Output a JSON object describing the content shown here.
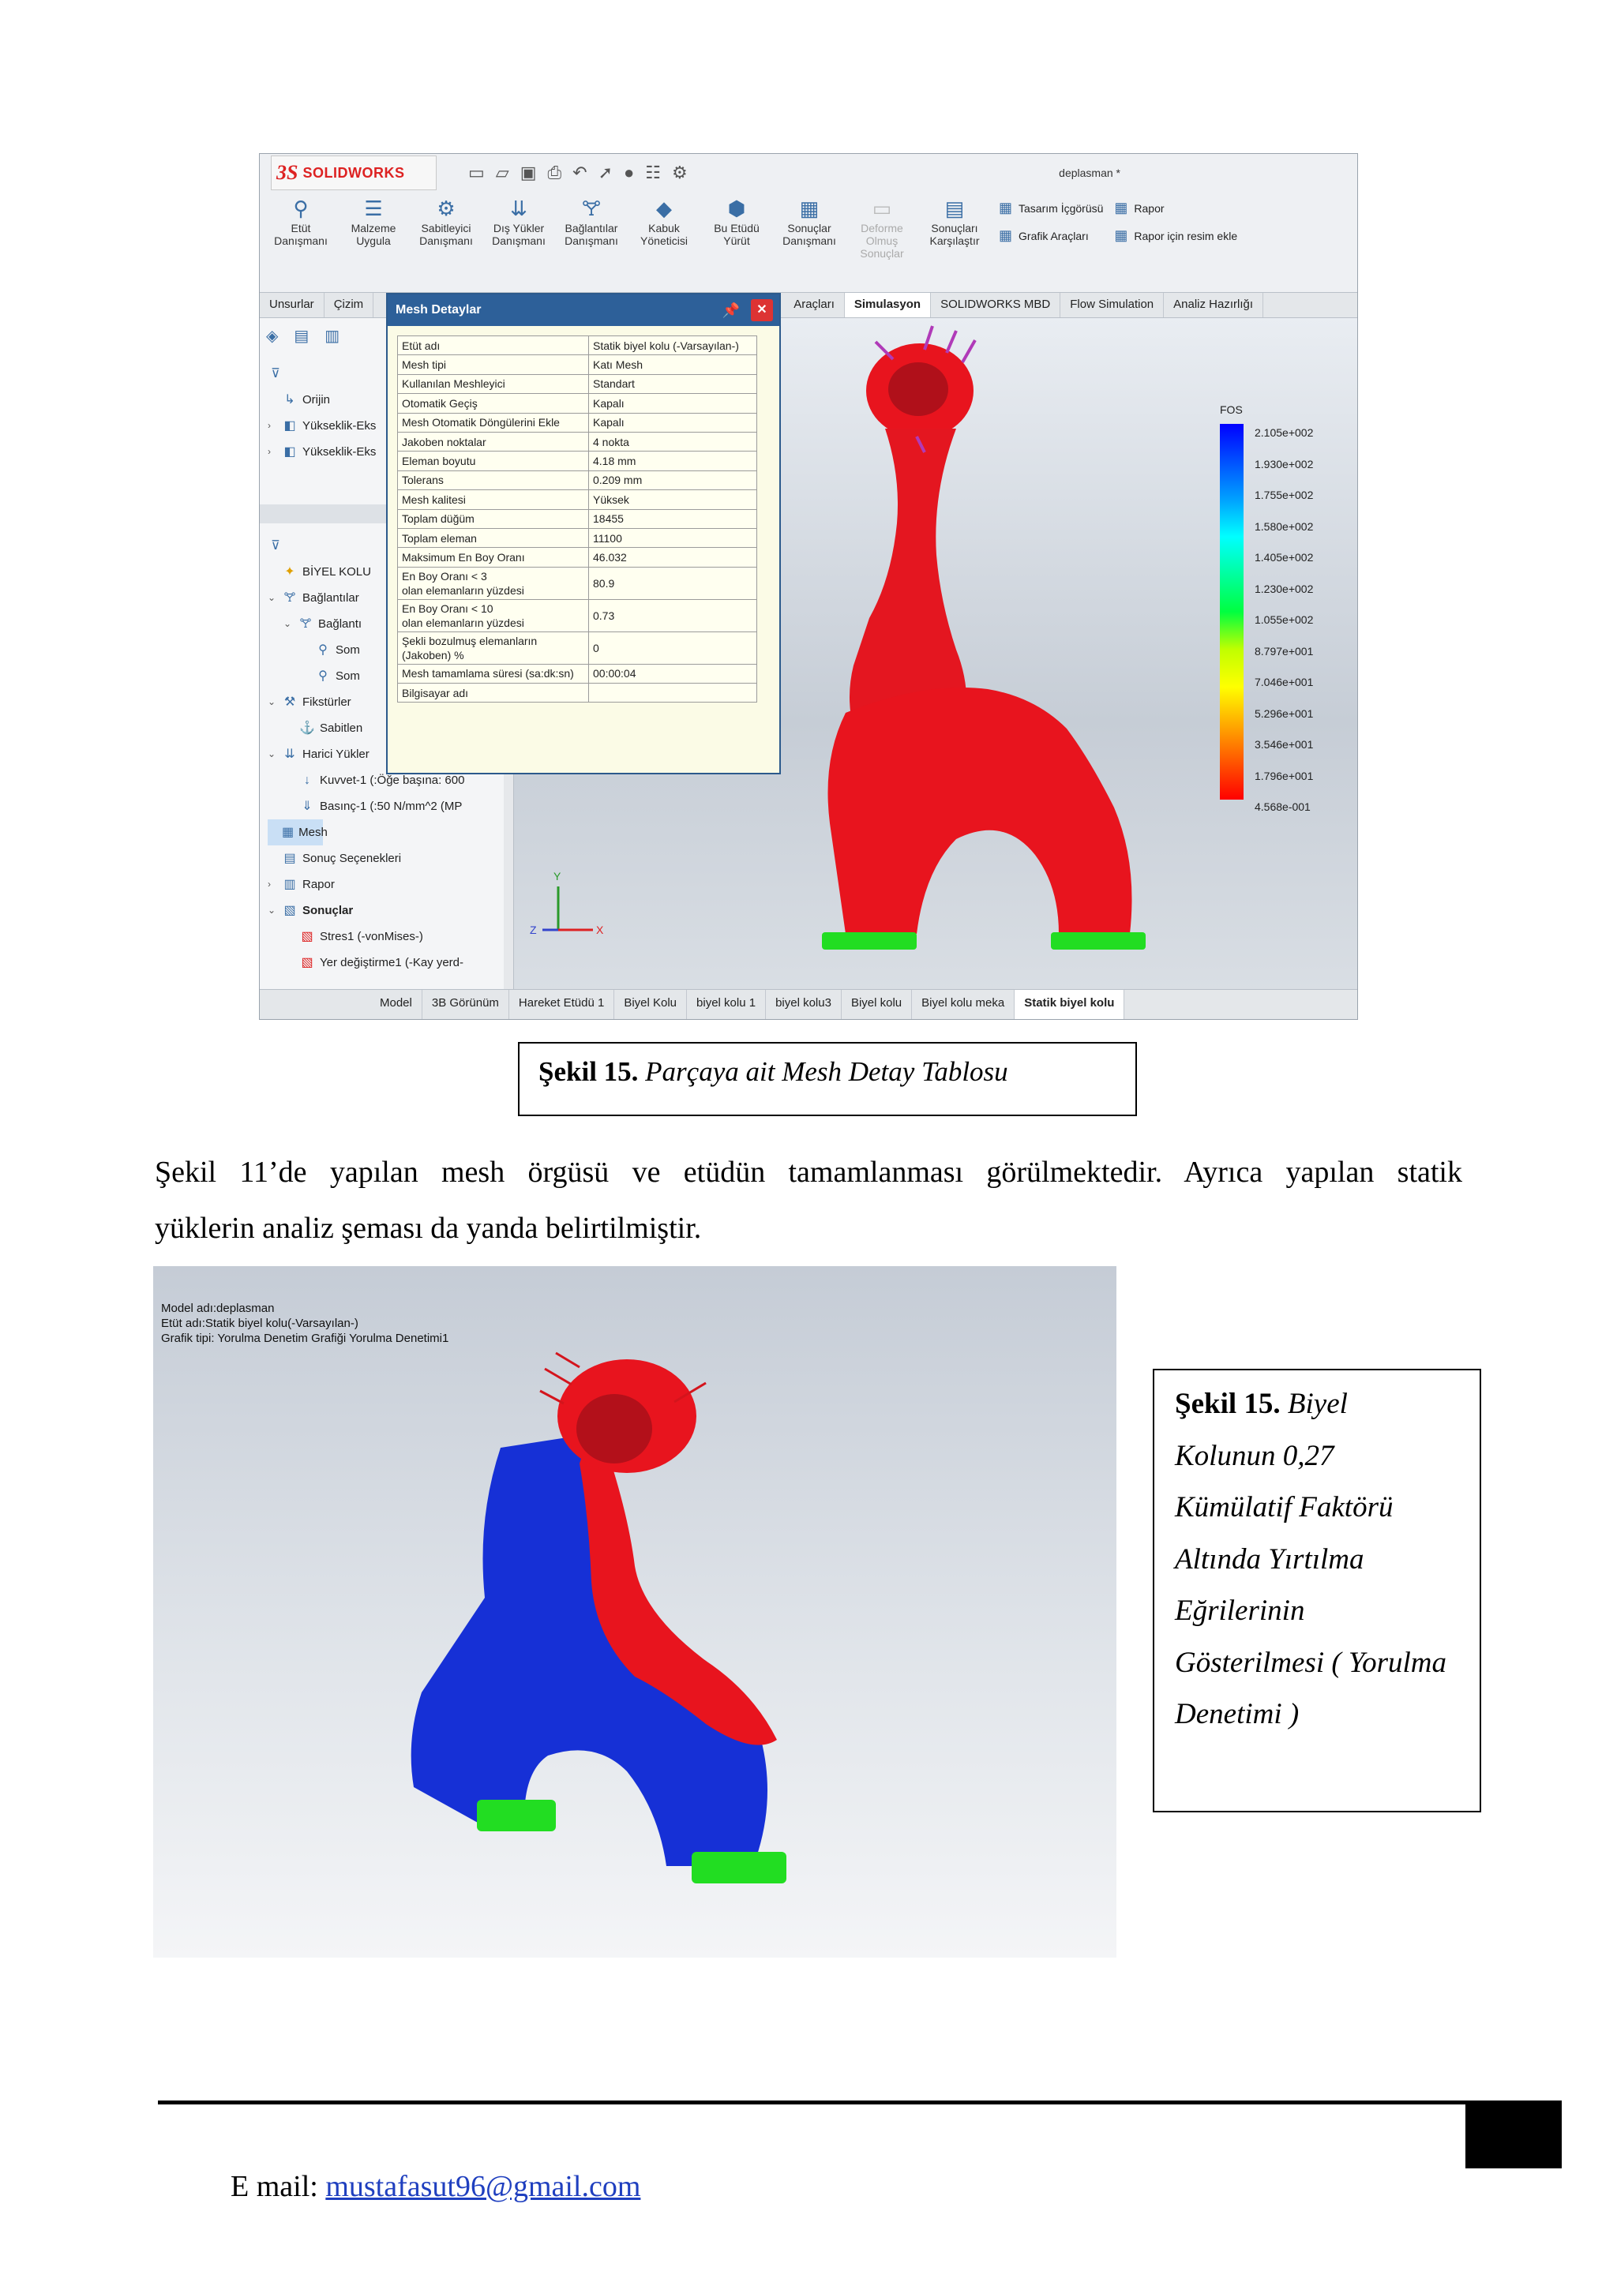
{
  "figure1": {
    "logo": "SOLIDWORKS",
    "document_name": "deplasman *",
    "ribbon": [
      {
        "label": "Etüt\nDanışmanı",
        "icon": "study-advisor-icon"
      },
      {
        "label": "Malzeme\nUygula",
        "icon": "apply-material-icon"
      },
      {
        "label": "Sabitleyici\nDanışmanı",
        "icon": "fixtures-advisor-icon"
      },
      {
        "label": "Dış Yükler\nDanışmanı",
        "icon": "external-loads-icon"
      },
      {
        "label": "Bağlantılar\nDanışmanı",
        "icon": "connections-advisor-icon"
      },
      {
        "label": "Kabuk\nYöneticisi",
        "icon": "shell-manager-icon"
      },
      {
        "label": "Bu Etüdü\nYürüt",
        "icon": "run-study-icon"
      },
      {
        "label": "Sonuçlar\nDanışmanı",
        "icon": "results-advisor-icon"
      },
      {
        "label": "Deforme\nOlmuş\nSonuçlar",
        "icon": "deformed-results-icon"
      },
      {
        "label": "Sonuçları\nKarşılaştır",
        "icon": "compare-results-icon"
      }
    ],
    "ribbon_stack1": [
      "Tasarım İçgörüsü",
      "Grafik Araçları"
    ],
    "ribbon_stack2": [
      "Rapor",
      "Rapor için resim ekle"
    ],
    "tabs": [
      "Unsurlar",
      "Çizim",
      "Araçları",
      "Simulasyon",
      "SOLIDWORKS MBD",
      "Flow Simulation",
      "Analiz Hazırlığı"
    ],
    "tree": {
      "origin": "Orijin",
      "plane1": "Yükseklik-Eks",
      "plane2": "Yükseklik-Eks",
      "part": "BİYEL KOLU",
      "connections": "Bağlantılar",
      "connection": "Bağlantı",
      "som1": "Som",
      "som2": "Som",
      "fixtures": "Fikstürler",
      "fixed": "Sabitlen",
      "external_loads": "Harici Yükler",
      "force": "Kuvvet-1 (:Öğe başına: 600",
      "pressure": "Basınç-1 (:50 N/mm^2 (MP",
      "mesh": "Mesh",
      "result_options": "Sonuç Seçenekleri",
      "report": "Rapor",
      "results": "Sonuçlar",
      "stress": "Stres1 (-vonMises-)",
      "displacement": "Yer değiştirme1 (-Kay yerd-"
    },
    "bottom_tabs": [
      "Model",
      "3B Görünüm",
      "Hareket Etüdü 1",
      "Biyel Kolu",
      "biyel kolu 1",
      "biyel kolu3",
      "Biyel kolu",
      "Biyel kolu meka",
      "Statik biyel kolu"
    ],
    "legend": {
      "title": "FOS",
      "labels": [
        "2.105e+002",
        "1.930e+002",
        "1.755e+002",
        "1.580e+002",
        "1.405e+002",
        "1.230e+002",
        "1.055e+002",
        "8.797e+001",
        "7.046e+001",
        "5.296e+001",
        "3.546e+001",
        "1.796e+001",
        "4.568e-001"
      ]
    },
    "dialog": {
      "title": "Mesh Detaylar",
      "rows": [
        [
          "Etüt adı",
          "Statik biyel kolu (-Varsayılan-)"
        ],
        [
          "Mesh tipi",
          "Katı Mesh"
        ],
        [
          "Kullanılan Meshleyici",
          "Standart"
        ],
        [
          "Otomatik Geçiş",
          "Kapalı"
        ],
        [
          "Mesh Otomatik Döngülerini Ekle",
          "Kapalı"
        ],
        [
          "Jakoben noktalar",
          "4 nokta"
        ],
        [
          "Eleman boyutu",
          "4.18 mm"
        ],
        [
          "Tolerans",
          "0.209 mm"
        ],
        [
          "Mesh kalitesi",
          "Yüksek"
        ],
        [
          "Toplam düğüm",
          "18455"
        ],
        [
          "Toplam eleman",
          "11100"
        ],
        [
          "Maksimum En Boy Oranı",
          "46.032"
        ],
        [
          "En Boy Oranı < 3\nolan elemanların yüzdesi",
          "80.9"
        ],
        [
          "En Boy Oranı < 10\nolan elemanların yüzdesi",
          "0.73"
        ],
        [
          "Şekli bozulmuş elemanların\n(Jakoben) %",
          "0"
        ],
        [
          "Mesh tamamlama süresi (sa:dk:sn)",
          "00:00:04"
        ],
        [
          "Bilgisayar adı",
          ""
        ]
      ]
    },
    "colors": {
      "accent_red": "#e8141e",
      "mesh_green": "#22dd22",
      "dialog_header": "#2d6099"
    }
  },
  "caption1": {
    "bold": "Şekil 15.",
    "italic": "Parçaya ait Mesh Detay Tablosu"
  },
  "paragraph": {
    "line1": "Şekil 11’de yapılan mesh örgüsü ve etüdün tamamlanması görülmektedir. Ayrıca yapılan statik",
    "line2": "yüklerin analiz şeması da yanda belirtilmiştir."
  },
  "figure2": {
    "info_line1": "Model adı:deplasman",
    "info_line2": "Etüt adı:Statik biyel kolu(-Varsayılan-)",
    "info_line3": "Grafik tipi: Yorulma Denetim Grafiği Yorulma Denetimi1"
  },
  "caption2": {
    "bold": "Şekil 15.",
    "lines": [
      "Biyel",
      "Kolunun 0,27",
      "Kümülatif Faktörü",
      "Altında Yırtılma",
      "Eğrilerinin",
      "Gösterilmesi ( Yorulma",
      "Denetimi )"
    ]
  },
  "footer": {
    "email_label": "E mail:",
    "email": "mustafasut96@gmail.com"
  }
}
